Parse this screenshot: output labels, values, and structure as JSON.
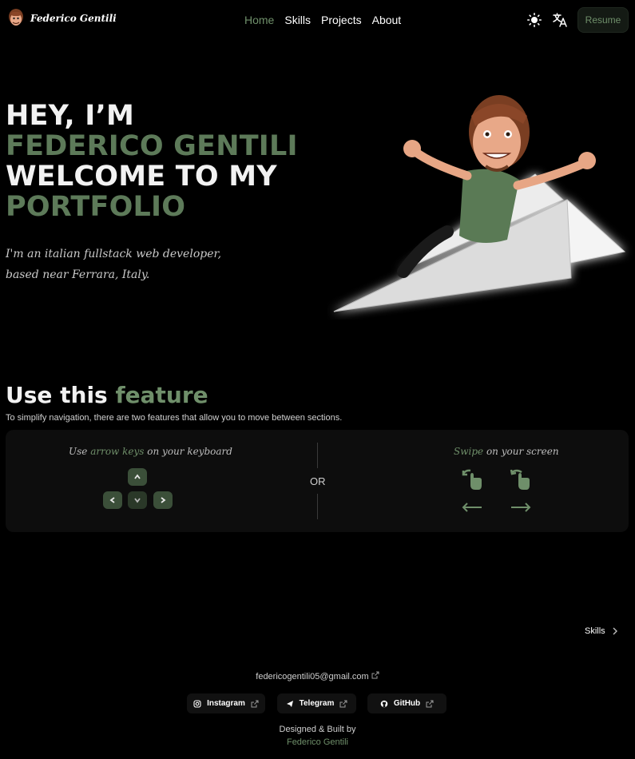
{
  "nav": {
    "brand_name": "Federico Gentili",
    "links": [
      "Home",
      "Skills",
      "Projects",
      "About"
    ],
    "active_link": "Home",
    "resume_label": "Resume",
    "icons": [
      "sun-icon",
      "translate-icon"
    ]
  },
  "hero": {
    "line1": "HEY, I’M",
    "line2": "FEDERICO GENTILI",
    "line3": "WELCOME TO MY",
    "line4": "PORTFOLIO",
    "subtitle": "I'm an italian fullstack web developer, based near Ferrara, Italy."
  },
  "feature": {
    "title_plain": "Use this",
    "title_accent": "feature",
    "description": "To simplify navigation, there are two features that allow you to move between sections.",
    "keys_prefix": "Use",
    "keys_accent": "arrow keys",
    "keys_suffix": "on your keyboard",
    "or_label": "OR",
    "swipe_accent": "Swipe",
    "swipe_suffix": "on your screen"
  },
  "next_section": {
    "label": "Skills"
  },
  "footer": {
    "email": "federicogentili05@gmail.com",
    "socials": [
      "Instagram",
      "Telegram",
      "GitHub"
    ],
    "credit_line": "Designed & Built by",
    "credit_name": "Federico Gentili"
  },
  "colors": {
    "accent": "#6f8f6a",
    "accent_dark": "#5d7a59",
    "background": "#000000",
    "card": "#0d0d0d"
  }
}
